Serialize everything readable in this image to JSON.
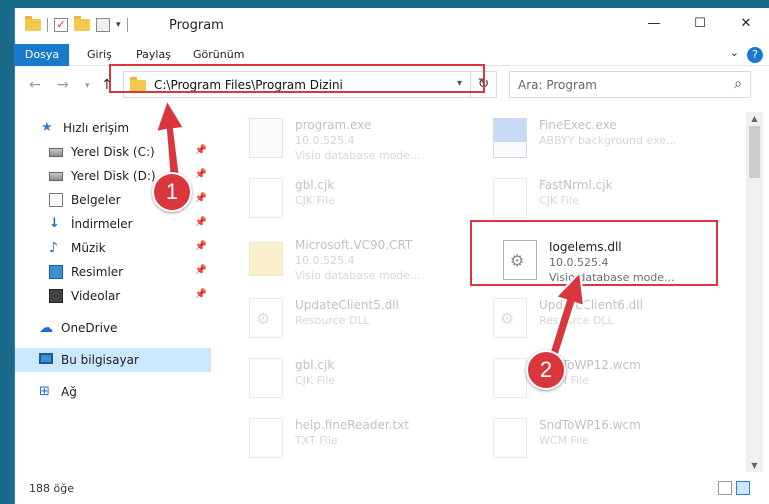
{
  "window": {
    "title": "Program",
    "minimize": "—",
    "maximize": "☐",
    "close": "✕"
  },
  "ribbon": {
    "tabs": [
      "Dosya",
      "Giriş",
      "Paylaş",
      "Görünüm"
    ]
  },
  "address": {
    "path": "C:\\Program Files\\Program Dizini"
  },
  "search": {
    "placeholder": "Ara: Program"
  },
  "sidebar": {
    "items": [
      {
        "label": "Hızlı erişim",
        "icon": "star-icon"
      },
      {
        "label": "Yerel Disk (C:)",
        "icon": "disk-icon"
      },
      {
        "label": "Yerel Disk (D:)",
        "icon": "disk-icon"
      },
      {
        "label": "Belgeler",
        "icon": "documents-icon"
      },
      {
        "label": "İndirmeler",
        "icon": "download-icon"
      },
      {
        "label": "Müzik",
        "icon": "music-icon"
      },
      {
        "label": "Resimler",
        "icon": "pictures-icon"
      },
      {
        "label": "Videolar",
        "icon": "videos-icon"
      },
      {
        "label": "OneDrive",
        "icon": "cloud-icon"
      },
      {
        "label": "Bu bilgisayar",
        "icon": "computer-icon"
      },
      {
        "label": "Ağ",
        "icon": "network-icon"
      }
    ]
  },
  "files": [
    {
      "name": "program.exe",
      "line2": "10.0.525.4",
      "line3": "Visio database mode..."
    },
    {
      "name": "FineExec.exe",
      "line2": "ABBYY background exe...",
      "line3": ""
    },
    {
      "name": "gbl.cjk",
      "line2": "CJK File",
      "line3": ""
    },
    {
      "name": "FastNrml.cjk",
      "line2": "CJK File",
      "line3": ""
    },
    {
      "name": "Microsoft.VC90.CRT",
      "line2": "10.0.525.4",
      "line3": "Visio database mode..."
    },
    {
      "name": "Iogelems.dll",
      "line2": "10.0.525.4",
      "line3": "Visio database mode..."
    },
    {
      "name": "UpdateClient5.dll",
      "line2": "Resource DLL",
      "line3": ""
    },
    {
      "name": "UpdateClient6.dll",
      "line2": "Resource DLL",
      "line3": ""
    },
    {
      "name": "gbl.cjk",
      "line2": "CJK File",
      "line3": ""
    },
    {
      "name": "SndToWP12.wcm",
      "line2": "WCM File",
      "line3": ""
    },
    {
      "name": "help.fineReader.txt",
      "line2": "TXT File",
      "line3": ""
    },
    {
      "name": "SndToWP16.wcm",
      "line2": "WCM File",
      "line3": ""
    }
  ],
  "status": {
    "count": "188 öğe"
  },
  "annotations": {
    "step1": "1",
    "step2": "2",
    "color": "#d9363e"
  }
}
